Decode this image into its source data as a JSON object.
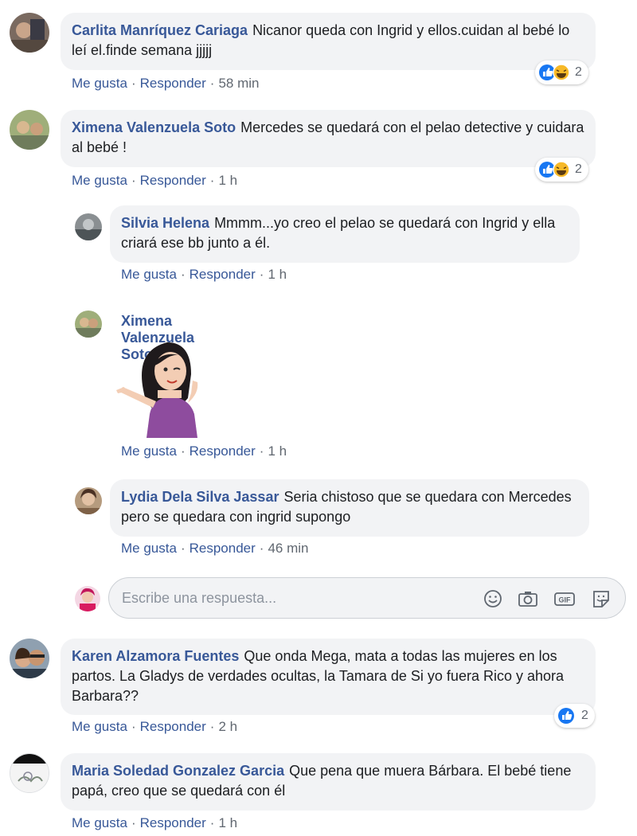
{
  "actions": {
    "like": "Me gusta",
    "reply": "Responder",
    "sep": "·"
  },
  "comments": [
    {
      "author": "Carlita Manríquez Cariaga",
      "text": "Nicanor queda con Ingrid y ellos.cuidan al bebé lo leí el.finde semana jjjjj",
      "time": "58 min",
      "reaction_count": "2"
    },
    {
      "author": "Ximena Valenzuela Soto",
      "text": "Mercedes se quedará con el pelao detective y cuidara al bebé !",
      "time": "1 h",
      "reaction_count": "2"
    },
    {
      "author": "Silvia Helena",
      "text": "Mmmm...yo creo el pelao se quedará con Ingrid y ella criará ese bb junto a él.",
      "time": "1 h"
    },
    {
      "author": "Ximena Valenzuela Soto",
      "text": "",
      "time": "1 h",
      "sticker": "waving-girl-sticker"
    },
    {
      "author": "Lydia Dela Silva Jassar",
      "text": "Seria chistoso que se quedara con Mercedes pero se quedara con ingrid supongo",
      "time": "46 min"
    },
    {
      "author": "Karen Alzamora Fuentes",
      "text": "Que onda Mega, mata a todas las mujeres en los partos. La Gladys de verdades ocultas, la Tamara de Si yo fuera Rico y ahora Barbara??",
      "time": "2 h",
      "reaction_count": "2"
    },
    {
      "author": "Maria Soledad Gonzalez Garcia",
      "text": "Que pena que muera Bárbara. El bebé tiene papá, creo que se quedará con él",
      "time": "1 h"
    }
  ],
  "reply_box": {
    "placeholder": "Escribe una respuesta...",
    "icons": [
      "emoji-icon",
      "camera-icon",
      "gif-icon",
      "sticker-icon"
    ]
  },
  "colors": {
    "link": "#385898",
    "bubble": "#f2f3f5",
    "like_blue": "#1877f2",
    "haha_yellow": "#f7b928"
  }
}
